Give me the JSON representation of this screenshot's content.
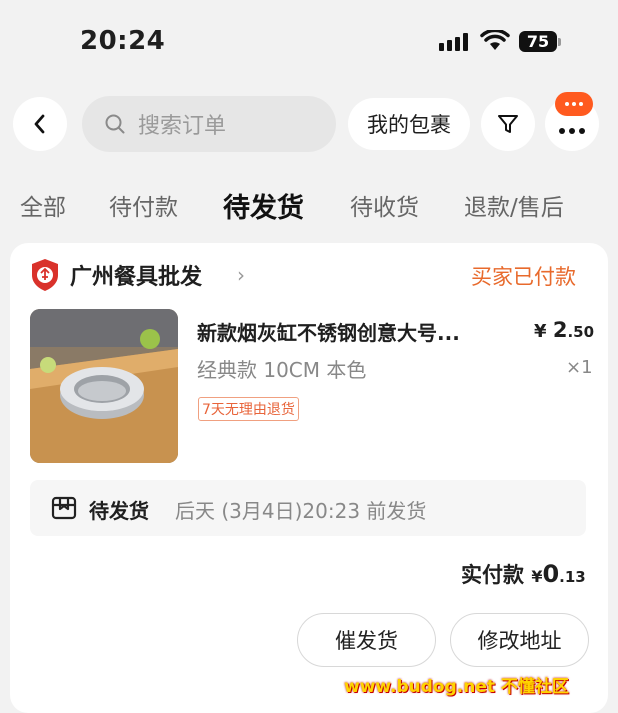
{
  "status_bar": {
    "time": "20:24",
    "battery": "75"
  },
  "search": {
    "placeholder": "搜索订单",
    "parcel_label": "我的包裹"
  },
  "tabs": [
    {
      "label": "全部",
      "active": false
    },
    {
      "label": "待付款",
      "active": false
    },
    {
      "label": "待发货",
      "active": true
    },
    {
      "label": "待收货",
      "active": false
    },
    {
      "label": "退款/售后",
      "active": false
    }
  ],
  "order": {
    "shop_name": "广州餐具批发",
    "status": "买家已付款",
    "product": {
      "title": "新款烟灰缸不锈钢创意大号...",
      "price_symbol": "¥",
      "price_int": "2",
      "price_dec": ".50",
      "variant": "经典款 10CM 本色",
      "quantity": "×1",
      "tag": "7天无理由退货"
    },
    "shipping": {
      "status": "待发货",
      "eta": "后天 (3月4日)20:23 前发货"
    },
    "paid": {
      "label": "实付款",
      "symbol": "¥",
      "amount": "0",
      "decimal": ".13"
    },
    "actions": {
      "remind": "催发货",
      "change_address": "修改地址"
    }
  },
  "watermark": "www.budog.net 不懂社区",
  "colors": {
    "accent": "#e86a2c",
    "badge": "#ff5a1f",
    "background": "#f2f2f2"
  }
}
